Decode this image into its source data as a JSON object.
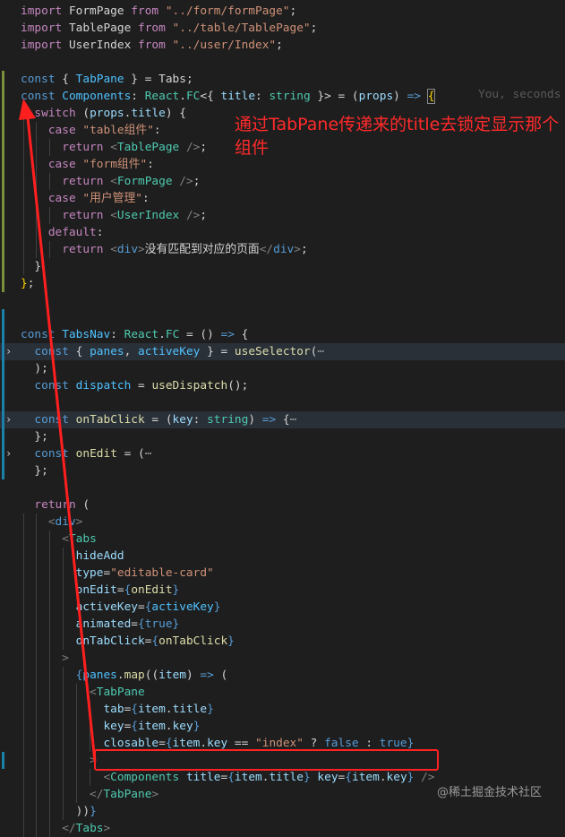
{
  "editor": {
    "blame_hint": "You, seconds",
    "lines": [
      [
        [
          "kw2",
          "import"
        ],
        [
          "txt",
          " FormPage "
        ],
        [
          "kw2",
          "from"
        ],
        [
          "txt",
          " "
        ],
        [
          "str",
          "\"../form/formPage\""
        ],
        [
          "txt",
          ";"
        ]
      ],
      [
        [
          "kw2",
          "import"
        ],
        [
          "txt",
          " TablePage "
        ],
        [
          "kw2",
          "from"
        ],
        [
          "txt",
          " "
        ],
        [
          "str",
          "\"../table/TablePage\""
        ],
        [
          "txt",
          ";"
        ]
      ],
      [
        [
          "kw2",
          "import"
        ],
        [
          "txt",
          " UserIndex "
        ],
        [
          "kw2",
          "from"
        ],
        [
          "txt",
          " "
        ],
        [
          "str",
          "\"../user/Index\""
        ],
        [
          "txt",
          ";"
        ]
      ],
      [],
      [
        [
          "kw",
          "const"
        ],
        [
          "txt",
          " { "
        ],
        [
          "cst",
          "TabPane"
        ],
        [
          "txt",
          " } = "
        ],
        [
          "txt",
          "Tabs;"
        ]
      ],
      [
        [
          "kw",
          "const"
        ],
        [
          "txt",
          " "
        ],
        [
          "cst",
          "Components"
        ],
        [
          "txt",
          ": "
        ],
        [
          "ty",
          "React"
        ],
        [
          "txt",
          "."
        ],
        [
          "ty",
          "FC"
        ],
        [
          "txt",
          "<{ "
        ],
        [
          "var",
          "title"
        ],
        [
          "txt",
          ": "
        ],
        [
          "ty",
          "string"
        ],
        [
          "txt",
          " }> = ("
        ],
        [
          "var",
          "props"
        ],
        [
          "txt",
          ") "
        ],
        [
          "kw",
          "=>"
        ],
        [
          "txt",
          " "
        ],
        [
          "brk",
          "{"
        ]
      ],
      [
        [
          "txt",
          "  "
        ],
        [
          "kw2",
          "switch"
        ],
        [
          "txt",
          " ("
        ],
        [
          "var",
          "props"
        ],
        [
          "txt",
          "."
        ],
        [
          "var",
          "title"
        ],
        [
          "txt",
          ") {"
        ]
      ],
      [
        [
          "txt",
          "    "
        ],
        [
          "kw2",
          "case"
        ],
        [
          "txt",
          " "
        ],
        [
          "str",
          "\"table组件\""
        ],
        [
          "txt",
          ":"
        ]
      ],
      [
        [
          "txt",
          "      "
        ],
        [
          "kw2",
          "return"
        ],
        [
          "txt",
          " "
        ],
        [
          "punc",
          "<"
        ],
        [
          "ty",
          "TablePage"
        ],
        [
          "txt",
          " "
        ],
        [
          "punc",
          "/>"
        ],
        [
          "txt",
          ";"
        ]
      ],
      [
        [
          "txt",
          "    "
        ],
        [
          "kw2",
          "case"
        ],
        [
          "txt",
          " "
        ],
        [
          "str",
          "\"form组件\""
        ],
        [
          "txt",
          ":"
        ]
      ],
      [
        [
          "txt",
          "      "
        ],
        [
          "kw2",
          "return"
        ],
        [
          "txt",
          " "
        ],
        [
          "punc",
          "<"
        ],
        [
          "ty",
          "FormPage"
        ],
        [
          "txt",
          " "
        ],
        [
          "punc",
          "/>"
        ],
        [
          "txt",
          ";"
        ]
      ],
      [
        [
          "txt",
          "    "
        ],
        [
          "kw2",
          "case"
        ],
        [
          "txt",
          " "
        ],
        [
          "str",
          "\"用户管理\""
        ],
        [
          "txt",
          ":"
        ]
      ],
      [
        [
          "txt",
          "      "
        ],
        [
          "kw2",
          "return"
        ],
        [
          "txt",
          " "
        ],
        [
          "punc",
          "<"
        ],
        [
          "ty",
          "UserIndex"
        ],
        [
          "txt",
          " "
        ],
        [
          "punc",
          "/>"
        ],
        [
          "txt",
          ";"
        ]
      ],
      [
        [
          "txt",
          "    "
        ],
        [
          "kw2",
          "default"
        ],
        [
          "txt",
          ":"
        ]
      ],
      [
        [
          "txt",
          "      "
        ],
        [
          "kw2",
          "return"
        ],
        [
          "txt",
          " "
        ],
        [
          "punc",
          "<"
        ],
        [
          "tag",
          "div"
        ],
        [
          "punc",
          ">"
        ],
        [
          "txt",
          "没有匹配到对应的页面"
        ],
        [
          "punc",
          "</"
        ],
        [
          "tag",
          "div"
        ],
        [
          "punc",
          ">"
        ],
        [
          "txt",
          ";"
        ]
      ],
      [
        [
          "txt",
          "  }"
        ]
      ],
      [
        [
          "brk",
          "}"
        ],
        [
          "txt",
          ";"
        ]
      ],
      [],
      [],
      [
        [
          "kw",
          "const"
        ],
        [
          "txt",
          " "
        ],
        [
          "cst",
          "TabsNav"
        ],
        [
          "txt",
          ": "
        ],
        [
          "ty",
          "React"
        ],
        [
          "txt",
          "."
        ],
        [
          "ty",
          "FC"
        ],
        [
          "txt",
          " = () "
        ],
        [
          "kw",
          "=>"
        ],
        [
          "txt",
          " {"
        ]
      ],
      [
        [
          "txt",
          "  "
        ],
        [
          "kw",
          "const"
        ],
        [
          "txt",
          " { "
        ],
        [
          "cst",
          "panes"
        ],
        [
          "txt",
          ", "
        ],
        [
          "cst",
          "activeKey"
        ],
        [
          "txt",
          " } = "
        ],
        [
          "fn",
          "useSelector"
        ],
        [
          "txt",
          "("
        ],
        [
          "ellip",
          "⋯"
        ]
      ],
      [
        [
          "txt",
          "  );"
        ]
      ],
      [
        [
          "txt",
          "  "
        ],
        [
          "kw",
          "const"
        ],
        [
          "txt",
          " "
        ],
        [
          "cst",
          "dispatch"
        ],
        [
          "txt",
          " = "
        ],
        [
          "fn",
          "useDispatch"
        ],
        [
          "txt",
          "();"
        ]
      ],
      [],
      [
        [
          "txt",
          "  "
        ],
        [
          "kw",
          "const"
        ],
        [
          "txt",
          " "
        ],
        [
          "fn",
          "onTabClick"
        ],
        [
          "txt",
          " = ("
        ],
        [
          "var",
          "key"
        ],
        [
          "txt",
          ": "
        ],
        [
          "ty",
          "string"
        ],
        [
          "txt",
          ") "
        ],
        [
          "kw",
          "=>"
        ],
        [
          "txt",
          " {"
        ],
        [
          "ellip",
          "⋯"
        ]
      ],
      [
        [
          "txt",
          "  };"
        ]
      ],
      [
        [
          "txt",
          "  "
        ],
        [
          "kw",
          "const"
        ],
        [
          "txt",
          " "
        ],
        [
          "fn",
          "onEdit"
        ],
        [
          "txt",
          " = ("
        ],
        [
          "ellip",
          "⋯"
        ]
      ],
      [
        [
          "txt",
          "  };"
        ]
      ],
      [],
      [
        [
          "txt",
          "  "
        ],
        [
          "kw2",
          "return"
        ],
        [
          "txt",
          " ("
        ]
      ],
      [
        [
          "txt",
          "    "
        ],
        [
          "punc",
          "<"
        ],
        [
          "tag",
          "div"
        ],
        [
          "punc",
          ">"
        ]
      ],
      [
        [
          "txt",
          "      "
        ],
        [
          "punc",
          "<"
        ],
        [
          "ty",
          "Tabs"
        ]
      ],
      [
        [
          "txt",
          "        "
        ],
        [
          "attr",
          "hideAdd"
        ]
      ],
      [
        [
          "txt",
          "        "
        ],
        [
          "attr",
          "type"
        ],
        [
          "txt",
          "="
        ],
        [
          "str",
          "\"editable-card\""
        ]
      ],
      [
        [
          "txt",
          "        "
        ],
        [
          "attr",
          "onEdit"
        ],
        [
          "txt",
          "="
        ],
        [
          "kw",
          "{"
        ],
        [
          "fn",
          "onEdit"
        ],
        [
          "kw",
          "}"
        ]
      ],
      [
        [
          "txt",
          "        "
        ],
        [
          "attr",
          "activeKey"
        ],
        [
          "txt",
          "="
        ],
        [
          "kw",
          "{"
        ],
        [
          "cst",
          "activeKey"
        ],
        [
          "kw",
          "}"
        ]
      ],
      [
        [
          "txt",
          "        "
        ],
        [
          "attr",
          "animated"
        ],
        [
          "txt",
          "="
        ],
        [
          "kw",
          "{"
        ],
        [
          "kw",
          "true"
        ],
        [
          "kw",
          "}"
        ]
      ],
      [
        [
          "txt",
          "        "
        ],
        [
          "attr",
          "onTabClick"
        ],
        [
          "txt",
          "="
        ],
        [
          "kw",
          "{"
        ],
        [
          "fn",
          "onTabClick"
        ],
        [
          "kw",
          "}"
        ]
      ],
      [
        [
          "txt",
          "      "
        ],
        [
          "punc",
          ">"
        ]
      ],
      [
        [
          "txt",
          "        "
        ],
        [
          "kw",
          "{"
        ],
        [
          "cst",
          "panes"
        ],
        [
          "txt",
          "."
        ],
        [
          "fn",
          "map"
        ],
        [
          "txt",
          "(("
        ],
        [
          "var",
          "item"
        ],
        [
          "txt",
          ") "
        ],
        [
          "kw",
          "=>"
        ],
        [
          "txt",
          " ("
        ]
      ],
      [
        [
          "txt",
          "          "
        ],
        [
          "punc",
          "<"
        ],
        [
          "ty",
          "TabPane"
        ]
      ],
      [
        [
          "txt",
          "            "
        ],
        [
          "attr",
          "tab"
        ],
        [
          "txt",
          "="
        ],
        [
          "kw",
          "{"
        ],
        [
          "var",
          "item"
        ],
        [
          "txt",
          "."
        ],
        [
          "var",
          "title"
        ],
        [
          "kw",
          "}"
        ]
      ],
      [
        [
          "txt",
          "            "
        ],
        [
          "attr",
          "key"
        ],
        [
          "txt",
          "="
        ],
        [
          "kw",
          "{"
        ],
        [
          "var",
          "item"
        ],
        [
          "txt",
          "."
        ],
        [
          "var",
          "key"
        ],
        [
          "kw",
          "}"
        ]
      ],
      [
        [
          "txt",
          "            "
        ],
        [
          "attr",
          "closable"
        ],
        [
          "txt",
          "="
        ],
        [
          "kw",
          "{"
        ],
        [
          "var",
          "item"
        ],
        [
          "txt",
          "."
        ],
        [
          "var",
          "key"
        ],
        [
          "txt",
          " == "
        ],
        [
          "str",
          "\"index\""
        ],
        [
          "txt",
          " ? "
        ],
        [
          "kw",
          "false"
        ],
        [
          "txt",
          " : "
        ],
        [
          "kw",
          "true"
        ],
        [
          "kw",
          "}"
        ]
      ],
      [
        [
          "txt",
          "          "
        ],
        [
          "punc",
          ">"
        ]
      ],
      [
        [
          "txt",
          "            "
        ],
        [
          "punc",
          "<"
        ],
        [
          "ty",
          "Components"
        ],
        [
          "txt",
          " "
        ],
        [
          "attr",
          "title"
        ],
        [
          "txt",
          "="
        ],
        [
          "kw",
          "{"
        ],
        [
          "var",
          "item"
        ],
        [
          "txt",
          "."
        ],
        [
          "var",
          "title"
        ],
        [
          "kw",
          "}"
        ],
        [
          "txt",
          " "
        ],
        [
          "attr",
          "key"
        ],
        [
          "txt",
          "="
        ],
        [
          "kw",
          "{"
        ],
        [
          "var",
          "item"
        ],
        [
          "txt",
          "."
        ],
        [
          "var",
          "key"
        ],
        [
          "kw",
          "}"
        ],
        [
          "txt",
          " "
        ],
        [
          "punc",
          "/>"
        ]
      ],
      [
        [
          "txt",
          "          "
        ],
        [
          "punc",
          "</"
        ],
        [
          "ty",
          "TabPane"
        ],
        [
          "punc",
          ">"
        ]
      ],
      [
        [
          "txt",
          "        "
        ],
        [
          "txt",
          "))"
        ],
        [
          "kw",
          "}"
        ]
      ],
      [
        [
          "txt",
          "      "
        ],
        [
          "punc",
          "</"
        ],
        [
          "ty",
          "Tabs"
        ],
        [
          "punc",
          ">"
        ]
      ]
    ]
  },
  "annotation": {
    "text": "通过TabPane传递来的title去锁定显示那个组件",
    "color": "#ff2a2a"
  },
  "watermark": "@稀土掘金技术社区",
  "colors": {
    "background": "#1e1e1e",
    "annotation_red": "#ff2222"
  }
}
